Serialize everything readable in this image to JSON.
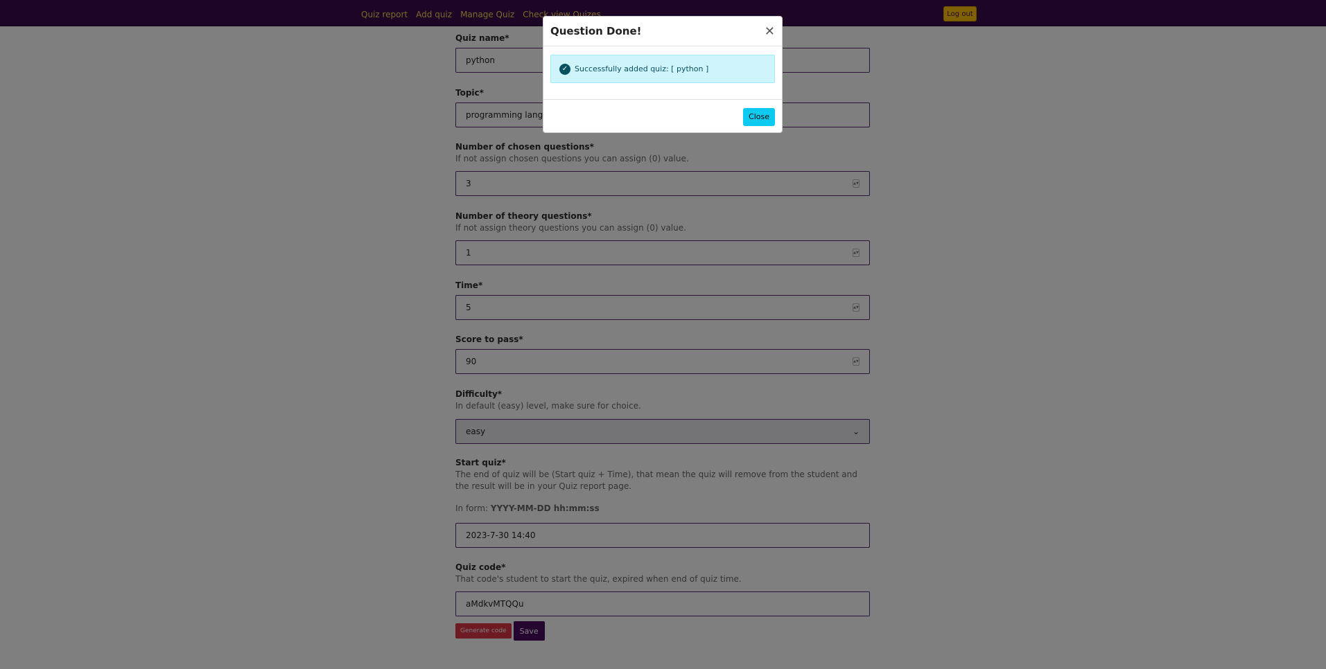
{
  "nav": {
    "links": [
      "Quiz report",
      "Add quiz",
      "Manage Quiz",
      "Check view Quizes"
    ],
    "logout_label": "Log out"
  },
  "form": {
    "quiz_name": {
      "label": "Quiz name*",
      "value": "python"
    },
    "topic": {
      "label": "Topic*",
      "value": "programming language"
    },
    "chosen_questions": {
      "label": "Number of chosen questions*",
      "help": "If not assign chosen questions you can assign (0) value.",
      "value": "3"
    },
    "theory_questions": {
      "label": "Number of theory questions*",
      "help": "If not assign theory questions you can assign (0) value.",
      "value": "1"
    },
    "time": {
      "label": "Time*",
      "value": "5"
    },
    "score": {
      "label": "Score to pass*",
      "value": "90"
    },
    "difficulty": {
      "label": "Difficulty*",
      "help": "In default (easy) level, make sure for choice.",
      "value": "easy"
    },
    "start_quiz": {
      "label": "Start quiz*",
      "help": "The end of quiz will be (Start quiz + Time), that mean the quiz will remove from the student and the result will be in your Quiz report page.",
      "format_prefix": "In form: ",
      "format": "YYYY-MM-DD hh:mm:ss",
      "value": "2023-7-30 14:40"
    },
    "quiz_code": {
      "label": "Quiz code*",
      "help": "That code's student to start the quiz, expired when end of quiz time.",
      "value": "aMdkvMTQQu"
    },
    "generate_label": "Generate code",
    "save_label": "Save"
  },
  "modal": {
    "title": "Question Done!",
    "message": "Successfully added quiz: [ python ]",
    "close_label": "Close"
  },
  "colors": {
    "navbar": "#3a0a4a",
    "nav_link": "#f6d35a",
    "logout": "#ffc107",
    "generate": "#dc3545",
    "save": "#4a0a5e",
    "alert_bg": "#cff4fc",
    "close_btn": "#0dcaf0"
  }
}
